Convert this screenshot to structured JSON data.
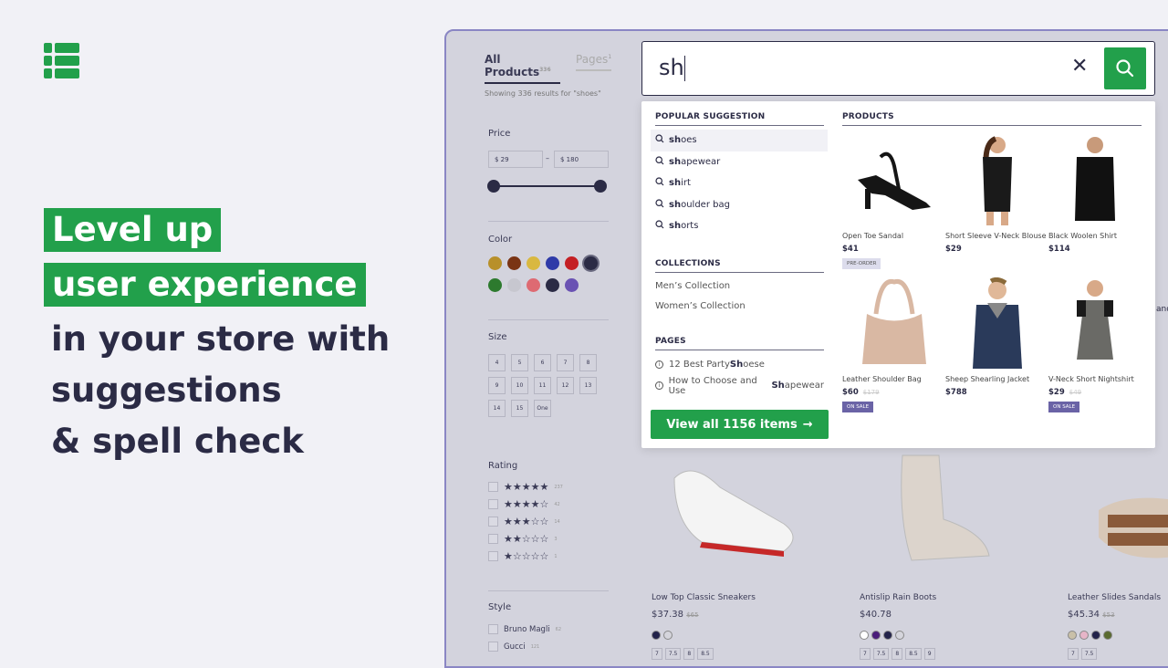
{
  "hero": {
    "highlight": [
      "Level up",
      "user experience"
    ],
    "plain": [
      "in your store with",
      "suggestions",
      "& spell check"
    ]
  },
  "brand_color": "#22a04b",
  "store": {
    "tabs": [
      {
        "label": "All Products",
        "count": "336"
      },
      {
        "label": "Pages",
        "count": "1"
      }
    ],
    "results_text": "Showing 336 results for \"shoes\"",
    "price": {
      "label": "Price",
      "min": "$ 29",
      "max": "$ 180"
    },
    "color": {
      "label": "Color",
      "swatches": [
        "#b8902a",
        "#7a3414",
        "#d9b840",
        "#2e3aa8",
        "#c41f24",
        "#2b2b45",
        "#2d7a2e",
        "#c7c7cf",
        "#de6a72",
        "#2b2b45",
        "#6a52b3"
      ]
    },
    "size": {
      "label": "Size",
      "options": [
        "4",
        "5",
        "6",
        "7",
        "8",
        "9",
        "10",
        "11",
        "12",
        "13",
        "14",
        "15",
        "One"
      ]
    },
    "rating": {
      "label": "Rating",
      "rows": [
        {
          "stars": 5,
          "count": "237"
        },
        {
          "stars": 4,
          "count": "42"
        },
        {
          "stars": 3,
          "count": "14"
        },
        {
          "stars": 2,
          "count": "3"
        },
        {
          "stars": 1,
          "count": "1"
        }
      ]
    },
    "style": {
      "label": "Style",
      "items": [
        {
          "name": "Bruno Magli",
          "count": "62"
        },
        {
          "name": "Gucci",
          "count": "121"
        }
      ]
    },
    "products": [
      {
        "name": "Low Top Classic Sneakers",
        "price": "$37.38",
        "old": "$65",
        "swatches": [
          "#23234a",
          "#d5d5dc"
        ],
        "sizes": [
          "7",
          "7.5",
          "8",
          "8.5"
        ]
      },
      {
        "name": "Antislip Rain Boots",
        "price": "$40.78",
        "old": "",
        "swatches": [
          "#ffffff",
          "#4a1d7a",
          "#23234a",
          "#d5d5dc"
        ],
        "sizes": [
          "7",
          "7.5",
          "8",
          "8.5",
          "9"
        ]
      },
      {
        "name": "Leather Slides Sandals",
        "price": "$45.34",
        "old": "$53",
        "swatches": [
          "#c9c0a8",
          "#e6b5c8",
          "#23234a",
          "#5a6a30"
        ],
        "sizes": [
          "7",
          "7.5"
        ]
      }
    ],
    "partial_text": "and"
  },
  "search": {
    "query": "sh"
  },
  "dropdown": {
    "popular_heading": "POPULAR SUGGESTION",
    "suggestions": [
      {
        "match": "sh",
        "rest": "oes"
      },
      {
        "match": "sh",
        "rest": "apewear"
      },
      {
        "match": "sh",
        "rest": "irt"
      },
      {
        "match": "sh",
        "rest": "oulder bag"
      },
      {
        "match": "sh",
        "rest": "orts"
      }
    ],
    "collections_heading": "COLLECTIONS",
    "collections": [
      "Men’s Collection",
      "Women’s Collection"
    ],
    "pages_heading": "PAGES",
    "pages": [
      {
        "pre": "12 Best Party ",
        "match": "Sh",
        "rest": "oese"
      },
      {
        "pre": "How to Choose and Use ",
        "match": "Sh",
        "rest": "apewear"
      }
    ],
    "view_all": "View all 1156 items",
    "products_heading": "PRODUCTS",
    "products": [
      {
        "name": "Open Toe Sandal",
        "price": "$41",
        "old": "",
        "badge": "PRE-ORDER",
        "img": "sandal"
      },
      {
        "name": "Short Sleeve V-Neck Blouse",
        "price": "$29",
        "old": "",
        "badge": "",
        "img": "blouse"
      },
      {
        "name": "Black Woolen Shirt",
        "price": "$114",
        "old": "",
        "badge": "",
        "img": "shirt"
      },
      {
        "name": "Leather Shoulder Bag",
        "price": "$60",
        "old": "$179",
        "badge": "ON SALE",
        "img": "bag"
      },
      {
        "name": "Sheep Shearling Jacket",
        "price": "$788",
        "old": "",
        "badge": "",
        "img": "jacket"
      },
      {
        "name": "V-Neck Short Nightshirt",
        "price": "$29",
        "old": "$49",
        "badge": "ON SALE",
        "img": "dress"
      }
    ]
  }
}
